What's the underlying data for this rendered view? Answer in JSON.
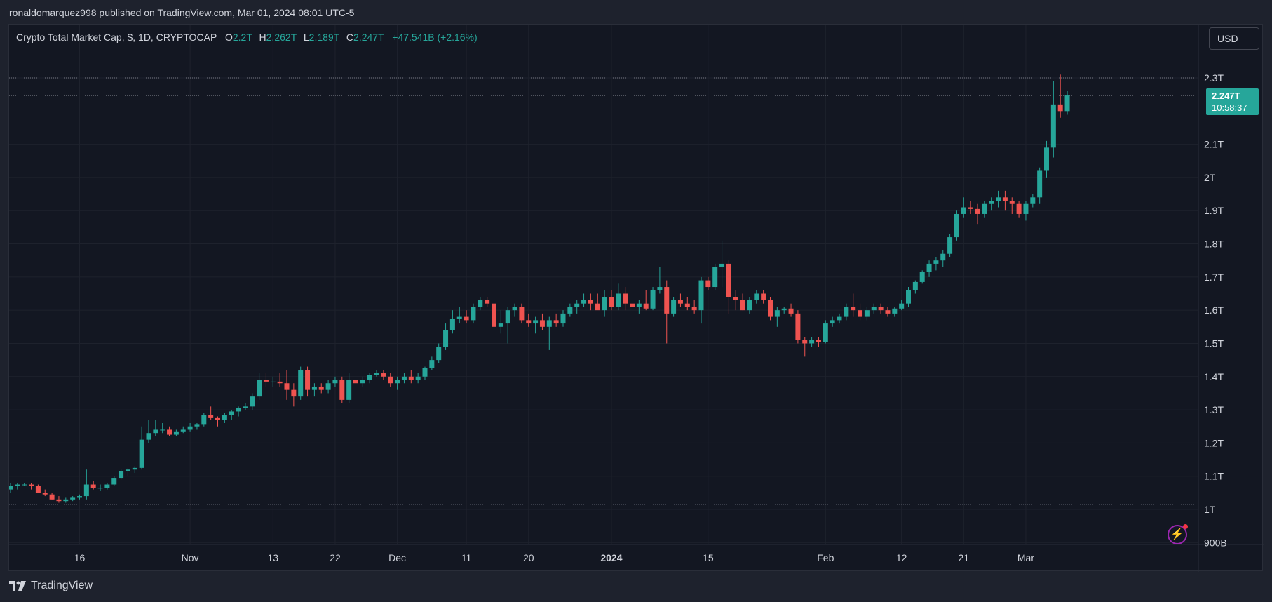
{
  "header": {
    "text": "ronaldomarquez998 published on TradingView.com, Mar 01, 2024 08:01 UTC-5"
  },
  "legend": {
    "symbol": "Crypto Total Market Cap, $, 1D, CRYPTOCAP",
    "o_label": "O",
    "o_value": "2.2T",
    "h_label": "H",
    "h_value": "2.262T",
    "l_label": "L",
    "l_value": "2.189T",
    "c_label": "C",
    "c_value": "2.247T",
    "change": "+47.541B (+2.16%)"
  },
  "currency_button": "USD",
  "last_price": {
    "value": "2.247T",
    "countdown": "10:58:37"
  },
  "footer": {
    "brand": "TradingView"
  },
  "colors": {
    "up": "#26a69a",
    "down": "#ef5350",
    "background": "#131722",
    "grid": "#1e222d",
    "text": "#d1d4dc"
  },
  "chart_data": {
    "type": "candlestick",
    "title": "Crypto Total Market Cap",
    "interval": "1D",
    "y_unit": "USD (trillions)",
    "ylim": [
      0.88,
      2.39
    ],
    "y_ticks": [
      {
        "value": 0.9,
        "label": "900B"
      },
      {
        "value": 1.0,
        "label": "1T"
      },
      {
        "value": 1.1,
        "label": "1.1T"
      },
      {
        "value": 1.2,
        "label": "1.2T"
      },
      {
        "value": 1.3,
        "label": "1.3T"
      },
      {
        "value": 1.4,
        "label": "1.4T"
      },
      {
        "value": 1.5,
        "label": "1.5T"
      },
      {
        "value": 1.6,
        "label": "1.6T"
      },
      {
        "value": 1.7,
        "label": "1.7T"
      },
      {
        "value": 1.8,
        "label": "1.8T"
      },
      {
        "value": 1.9,
        "label": "1.9T"
      },
      {
        "value": 2.0,
        "label": "2T"
      },
      {
        "value": 2.1,
        "label": "2.1T"
      },
      {
        "value": 2.3,
        "label": "2.3T"
      }
    ],
    "x_ticks": [
      {
        "date": "2023-10-16",
        "label": "16"
      },
      {
        "date": "2023-11-01",
        "label": "Nov"
      },
      {
        "date": "2023-11-13",
        "label": "13"
      },
      {
        "date": "2023-11-22",
        "label": "22"
      },
      {
        "date": "2023-12-01",
        "label": "Dec"
      },
      {
        "date": "2023-12-11",
        "label": "11"
      },
      {
        "date": "2023-12-20",
        "label": "20"
      },
      {
        "date": "2024-01-01",
        "label": "2024"
      },
      {
        "date": "2024-01-15",
        "label": "15"
      },
      {
        "date": "2024-02-01",
        "label": "Feb"
      },
      {
        "date": "2024-02-12",
        "label": "12"
      },
      {
        "date": "2024-02-21",
        "label": "21"
      },
      {
        "date": "2024-03-01",
        "label": "Mar"
      }
    ],
    "reference_lines": [
      2.3,
      2.247,
      1.015
    ],
    "last_close": 2.247,
    "first_date": "2023-10-06",
    "candles": [
      [
        1.06,
        1.08,
        1.05,
        1.07
      ],
      [
        1.07,
        1.08,
        1.06,
        1.075
      ],
      [
        1.075,
        1.08,
        1.07,
        1.075
      ],
      [
        1.075,
        1.08,
        1.06,
        1.07
      ],
      [
        1.07,
        1.075,
        1.05,
        1.05
      ],
      [
        1.05,
        1.06,
        1.04,
        1.045
      ],
      [
        1.045,
        1.05,
        1.03,
        1.03
      ],
      [
        1.03,
        1.04,
        1.02,
        1.025
      ],
      [
        1.025,
        1.035,
        1.02,
        1.03
      ],
      [
        1.03,
        1.04,
        1.025,
        1.035
      ],
      [
        1.035,
        1.045,
        1.03,
        1.04
      ],
      [
        1.04,
        1.12,
        1.03,
        1.075
      ],
      [
        1.075,
        1.085,
        1.06,
        1.065
      ],
      [
        1.065,
        1.075,
        1.055,
        1.065
      ],
      [
        1.065,
        1.08,
        1.06,
        1.075
      ],
      [
        1.075,
        1.1,
        1.07,
        1.095
      ],
      [
        1.095,
        1.12,
        1.09,
        1.115
      ],
      [
        1.115,
        1.125,
        1.1,
        1.12
      ],
      [
        1.12,
        1.13,
        1.11,
        1.125
      ],
      [
        1.125,
        1.25,
        1.12,
        1.21
      ],
      [
        1.21,
        1.27,
        1.2,
        1.23
      ],
      [
        1.23,
        1.27,
        1.22,
        1.24
      ],
      [
        1.24,
        1.26,
        1.23,
        1.24
      ],
      [
        1.24,
        1.25,
        1.22,
        1.225
      ],
      [
        1.225,
        1.24,
        1.22,
        1.235
      ],
      [
        1.235,
        1.25,
        1.23,
        1.24
      ],
      [
        1.24,
        1.26,
        1.235,
        1.25
      ],
      [
        1.25,
        1.26,
        1.24,
        1.255
      ],
      [
        1.255,
        1.29,
        1.25,
        1.285
      ],
      [
        1.285,
        1.31,
        1.27,
        1.275
      ],
      [
        1.275,
        1.28,
        1.25,
        1.27
      ],
      [
        1.27,
        1.29,
        1.26,
        1.285
      ],
      [
        1.285,
        1.3,
        1.27,
        1.295
      ],
      [
        1.295,
        1.31,
        1.28,
        1.305
      ],
      [
        1.305,
        1.32,
        1.3,
        1.31
      ],
      [
        1.31,
        1.35,
        1.3,
        1.34
      ],
      [
        1.34,
        1.41,
        1.33,
        1.39
      ],
      [
        1.39,
        1.41,
        1.37,
        1.385
      ],
      [
        1.385,
        1.4,
        1.37,
        1.385
      ],
      [
        1.385,
        1.41,
        1.37,
        1.38
      ],
      [
        1.38,
        1.42,
        1.33,
        1.36
      ],
      [
        1.36,
        1.38,
        1.31,
        1.34
      ],
      [
        1.34,
        1.43,
        1.33,
        1.42
      ],
      [
        1.42,
        1.43,
        1.34,
        1.36
      ],
      [
        1.36,
        1.38,
        1.34,
        1.37
      ],
      [
        1.37,
        1.38,
        1.35,
        1.36
      ],
      [
        1.36,
        1.39,
        1.35,
        1.38
      ],
      [
        1.38,
        1.4,
        1.37,
        1.39
      ],
      [
        1.39,
        1.4,
        1.32,
        1.33
      ],
      [
        1.33,
        1.41,
        1.32,
        1.39
      ],
      [
        1.39,
        1.4,
        1.37,
        1.38
      ],
      [
        1.38,
        1.4,
        1.37,
        1.39
      ],
      [
        1.39,
        1.41,
        1.38,
        1.405
      ],
      [
        1.405,
        1.42,
        1.4,
        1.41
      ],
      [
        1.41,
        1.42,
        1.39,
        1.4
      ],
      [
        1.4,
        1.41,
        1.37,
        1.38
      ],
      [
        1.38,
        1.4,
        1.36,
        1.39
      ],
      [
        1.39,
        1.41,
        1.38,
        1.4
      ],
      [
        1.4,
        1.42,
        1.38,
        1.39
      ],
      [
        1.39,
        1.41,
        1.38,
        1.4
      ],
      [
        1.4,
        1.43,
        1.39,
        1.425
      ],
      [
        1.425,
        1.46,
        1.42,
        1.45
      ],
      [
        1.45,
        1.5,
        1.44,
        1.49
      ],
      [
        1.49,
        1.56,
        1.48,
        1.54
      ],
      [
        1.54,
        1.6,
        1.53,
        1.575
      ],
      [
        1.575,
        1.61,
        1.56,
        1.58
      ],
      [
        1.58,
        1.6,
        1.56,
        1.57
      ],
      [
        1.57,
        1.62,
        1.56,
        1.61
      ],
      [
        1.61,
        1.64,
        1.6,
        1.63
      ],
      [
        1.63,
        1.64,
        1.61,
        1.62
      ],
      [
        1.62,
        1.63,
        1.47,
        1.55
      ],
      [
        1.55,
        1.6,
        1.53,
        1.56
      ],
      [
        1.56,
        1.61,
        1.5,
        1.6
      ],
      [
        1.6,
        1.62,
        1.58,
        1.61
      ],
      [
        1.61,
        1.62,
        1.56,
        1.57
      ],
      [
        1.57,
        1.59,
        1.55,
        1.56
      ],
      [
        1.56,
        1.58,
        1.53,
        1.57
      ],
      [
        1.57,
        1.59,
        1.54,
        1.55
      ],
      [
        1.55,
        1.58,
        1.48,
        1.57
      ],
      [
        1.57,
        1.59,
        1.55,
        1.56
      ],
      [
        1.56,
        1.6,
        1.55,
        1.59
      ],
      [
        1.59,
        1.62,
        1.58,
        1.61
      ],
      [
        1.61,
        1.63,
        1.59,
        1.62
      ],
      [
        1.62,
        1.65,
        1.61,
        1.63
      ],
      [
        1.63,
        1.65,
        1.6,
        1.62
      ],
      [
        1.62,
        1.65,
        1.61,
        1.6
      ],
      [
        1.6,
        1.66,
        1.58,
        1.64
      ],
      [
        1.64,
        1.66,
        1.6,
        1.61
      ],
      [
        1.61,
        1.68,
        1.6,
        1.65
      ],
      [
        1.65,
        1.67,
        1.6,
        1.62
      ],
      [
        1.62,
        1.64,
        1.6,
        1.61
      ],
      [
        1.61,
        1.63,
        1.59,
        1.62
      ],
      [
        1.62,
        1.66,
        1.6,
        1.605
      ],
      [
        1.605,
        1.67,
        1.6,
        1.66
      ],
      [
        1.66,
        1.73,
        1.65,
        1.67
      ],
      [
        1.67,
        1.69,
        1.5,
        1.59
      ],
      [
        1.59,
        1.64,
        1.58,
        1.63
      ],
      [
        1.63,
        1.65,
        1.61,
        1.62
      ],
      [
        1.62,
        1.64,
        1.6,
        1.61
      ],
      [
        1.61,
        1.63,
        1.59,
        1.6
      ],
      [
        1.6,
        1.7,
        1.56,
        1.69
      ],
      [
        1.69,
        1.7,
        1.66,
        1.67
      ],
      [
        1.67,
        1.74,
        1.66,
        1.73
      ],
      [
        1.73,
        1.81,
        1.67,
        1.74
      ],
      [
        1.74,
        1.75,
        1.59,
        1.64
      ],
      [
        1.64,
        1.66,
        1.6,
        1.63
      ],
      [
        1.63,
        1.65,
        1.6,
        1.6
      ],
      [
        1.6,
        1.64,
        1.59,
        1.63
      ],
      [
        1.63,
        1.66,
        1.62,
        1.65
      ],
      [
        1.65,
        1.66,
        1.62,
        1.63
      ],
      [
        1.63,
        1.64,
        1.57,
        1.58
      ],
      [
        1.58,
        1.61,
        1.55,
        1.6
      ],
      [
        1.6,
        1.61,
        1.59,
        1.605
      ],
      [
        1.605,
        1.62,
        1.58,
        1.59
      ],
      [
        1.59,
        1.6,
        1.5,
        1.51
      ],
      [
        1.51,
        1.52,
        1.46,
        1.5
      ],
      [
        1.5,
        1.52,
        1.49,
        1.51
      ],
      [
        1.51,
        1.52,
        1.49,
        1.505
      ],
      [
        1.505,
        1.57,
        1.5,
        1.56
      ],
      [
        1.56,
        1.58,
        1.55,
        1.57
      ],
      [
        1.57,
        1.59,
        1.56,
        1.58
      ],
      [
        1.58,
        1.62,
        1.57,
        1.61
      ],
      [
        1.61,
        1.65,
        1.58,
        1.6
      ],
      [
        1.6,
        1.62,
        1.57,
        1.58
      ],
      [
        1.58,
        1.61,
        1.57,
        1.6
      ],
      [
        1.6,
        1.62,
        1.59,
        1.61
      ],
      [
        1.61,
        1.62,
        1.59,
        1.6
      ],
      [
        1.6,
        1.61,
        1.58,
        1.59
      ],
      [
        1.59,
        1.61,
        1.58,
        1.605
      ],
      [
        1.605,
        1.63,
        1.6,
        1.62
      ],
      [
        1.62,
        1.67,
        1.61,
        1.66
      ],
      [
        1.66,
        1.69,
        1.65,
        1.685
      ],
      [
        1.685,
        1.72,
        1.68,
        1.715
      ],
      [
        1.715,
        1.75,
        1.7,
        1.74
      ],
      [
        1.74,
        1.76,
        1.72,
        1.75
      ],
      [
        1.75,
        1.78,
        1.73,
        1.77
      ],
      [
        1.77,
        1.83,
        1.76,
        1.82
      ],
      [
        1.82,
        1.9,
        1.81,
        1.89
      ],
      [
        1.89,
        1.94,
        1.88,
        1.91
      ],
      [
        1.91,
        1.93,
        1.89,
        1.905
      ],
      [
        1.905,
        1.92,
        1.86,
        1.89
      ],
      [
        1.89,
        1.93,
        1.88,
        1.92
      ],
      [
        1.92,
        1.94,
        1.9,
        1.93
      ],
      [
        1.93,
        1.96,
        1.91,
        1.94
      ],
      [
        1.94,
        1.96,
        1.9,
        1.93
      ],
      [
        1.93,
        1.94,
        1.89,
        1.92
      ],
      [
        1.92,
        1.93,
        1.88,
        1.89
      ],
      [
        1.89,
        1.93,
        1.87,
        1.92
      ],
      [
        1.92,
        1.95,
        1.91,
        1.94
      ],
      [
        1.94,
        2.03,
        1.92,
        2.02
      ],
      [
        2.02,
        2.11,
        2.0,
        2.09
      ],
      [
        2.09,
        2.29,
        2.06,
        2.22
      ],
      [
        2.22,
        2.31,
        2.18,
        2.2
      ],
      [
        2.2,
        2.262,
        2.189,
        2.247
      ]
    ]
  }
}
